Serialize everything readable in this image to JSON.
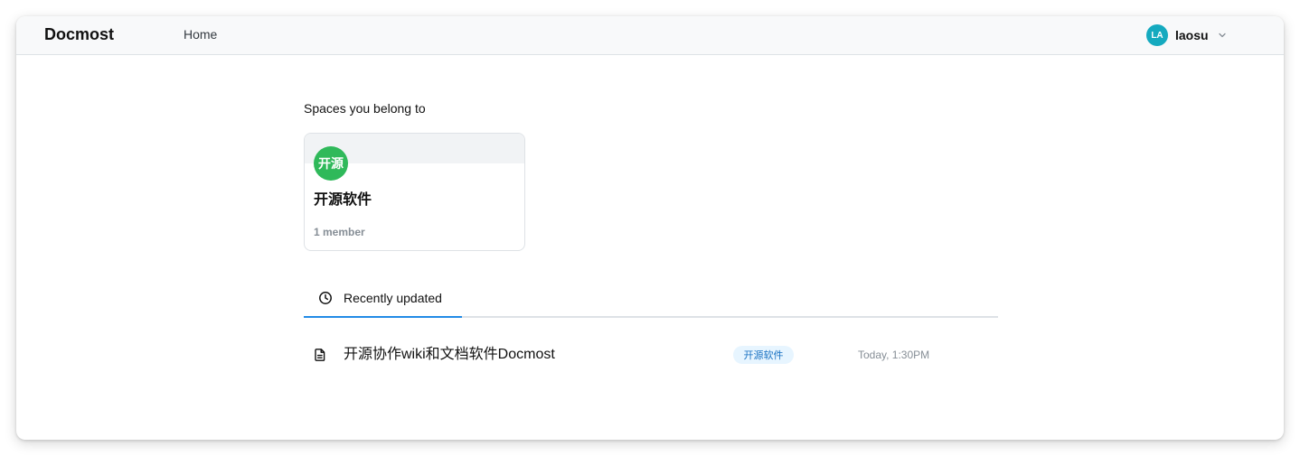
{
  "header": {
    "logo": "Docmost",
    "nav": [
      {
        "label": "Home"
      }
    ],
    "user": {
      "initials": "LA",
      "name": "laosu",
      "menu_icon": "chevron-down-icon"
    }
  },
  "spaces": {
    "heading": "Spaces you belong to",
    "items": [
      {
        "initials": "开源",
        "name": "开源软件",
        "members": "1 member"
      }
    ]
  },
  "tabs": [
    {
      "label": "Recently updated",
      "icon": "clock-icon",
      "active": true
    }
  ],
  "recent": [
    {
      "icon": "file-icon",
      "title": "开源协作wiki和文档软件Docmost",
      "space": "开源软件",
      "updated": "Today, 1:30PM"
    }
  ],
  "colors": {
    "accent": "#228be6",
    "user_avatar": "#15aabf",
    "space_avatar": "#2fb95a",
    "badge_background": "#e7f5ff",
    "badge_text": "#1971c2",
    "muted_text": "#868e96"
  }
}
